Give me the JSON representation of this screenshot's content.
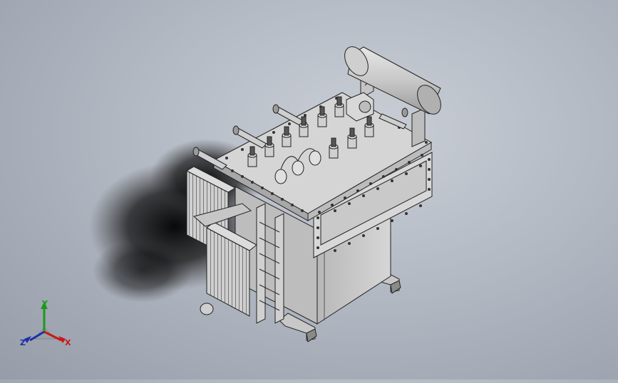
{
  "colors": {
    "background_center": "#c9ced6",
    "background_edge": "#969ca8",
    "body_light": "#dedede",
    "body_mid": "#c4c4c4",
    "body_dark": "#8e8e8e",
    "edge": "#222222",
    "axis_x": "#c81818",
    "axis_y": "#1a9a1a",
    "axis_z": "#1b2fa8"
  },
  "model": {
    "name": "transformer-3d-model"
  },
  "triad": {
    "x_label": "X",
    "y_label": "Y",
    "z_label": "Z"
  }
}
